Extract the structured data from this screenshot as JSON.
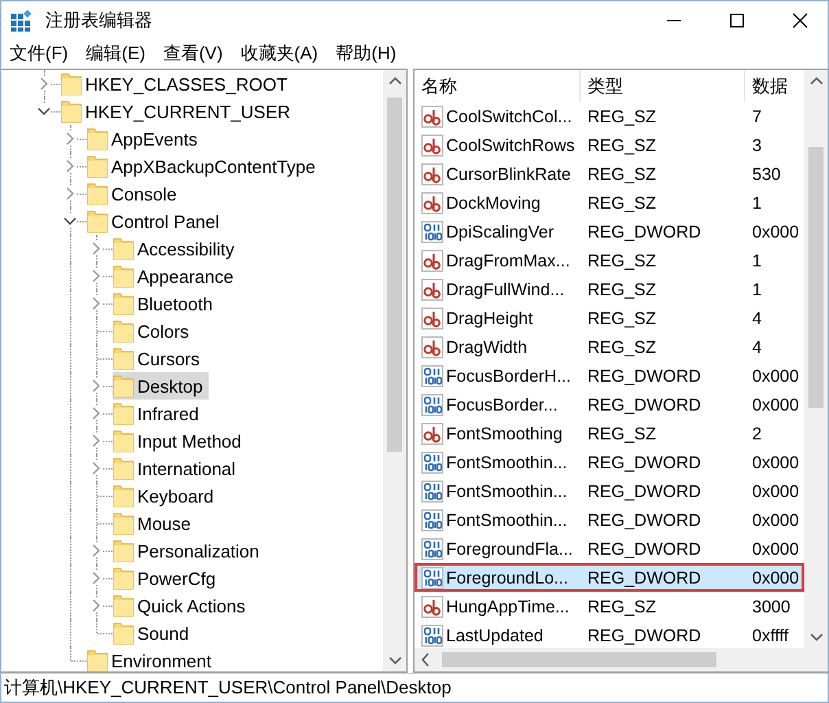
{
  "window": {
    "title": "注册表编辑器"
  },
  "menu": [
    "文件(F)",
    "编辑(E)",
    "查看(V)",
    "收藏夹(A)",
    "帮助(H)"
  ],
  "tree": [
    {
      "label": "HKEY_CLASSES_ROOT",
      "expandable": true,
      "expanded": false,
      "selected": false
    },
    {
      "label": "HKEY_CURRENT_USER",
      "expandable": true,
      "expanded": true,
      "selected": false,
      "children": [
        {
          "label": "AppEvents",
          "expandable": true,
          "expanded": false,
          "selected": false
        },
        {
          "label": "AppXBackupContentType",
          "expandable": true,
          "expanded": false,
          "selected": false
        },
        {
          "label": "Console",
          "expandable": true,
          "expanded": false,
          "selected": false
        },
        {
          "label": "Control Panel",
          "expandable": true,
          "expanded": true,
          "selected": false,
          "children": [
            {
              "label": "Accessibility",
              "expandable": true,
              "expanded": false,
              "selected": false
            },
            {
              "label": "Appearance",
              "expandable": true,
              "expanded": false,
              "selected": false
            },
            {
              "label": "Bluetooth",
              "expandable": true,
              "expanded": false,
              "selected": false
            },
            {
              "label": "Colors",
              "expandable": false,
              "selected": false
            },
            {
              "label": "Cursors",
              "expandable": false,
              "selected": false
            },
            {
              "label": "Desktop",
              "expandable": true,
              "expanded": false,
              "selected": true
            },
            {
              "label": "Infrared",
              "expandable": true,
              "expanded": false,
              "selected": false
            },
            {
              "label": "Input Method",
              "expandable": true,
              "expanded": false,
              "selected": false
            },
            {
              "label": "International",
              "expandable": true,
              "expanded": false,
              "selected": false
            },
            {
              "label": "Keyboard",
              "expandable": false,
              "selected": false
            },
            {
              "label": "Mouse",
              "expandable": false,
              "selected": false
            },
            {
              "label": "Personalization",
              "expandable": true,
              "expanded": false,
              "selected": false
            },
            {
              "label": "PowerCfg",
              "expandable": true,
              "expanded": false,
              "selected": false
            },
            {
              "label": "Quick Actions",
              "expandable": true,
              "expanded": false,
              "selected": false
            },
            {
              "label": "Sound",
              "expandable": false,
              "selected": false
            }
          ]
        },
        {
          "label": "Environment",
          "expandable": false,
          "selected": false
        }
      ]
    }
  ],
  "table": {
    "columns": [
      "名称",
      "类型",
      "数据"
    ],
    "rows": [
      {
        "kind": "string",
        "name": "CoolSwitchCol...",
        "type": "REG_SZ",
        "data": "7",
        "selected": false,
        "outlined": false
      },
      {
        "kind": "string",
        "name": "CoolSwitchRows",
        "type": "REG_SZ",
        "data": "3",
        "selected": false,
        "outlined": false
      },
      {
        "kind": "string",
        "name": "CursorBlinkRate",
        "type": "REG_SZ",
        "data": "530",
        "selected": false,
        "outlined": false
      },
      {
        "kind": "string",
        "name": "DockMoving",
        "type": "REG_SZ",
        "data": "1",
        "selected": false,
        "outlined": false
      },
      {
        "kind": "dword",
        "name": "DpiScalingVer",
        "type": "REG_DWORD",
        "data": "0x000",
        "selected": false,
        "outlined": false
      },
      {
        "kind": "string",
        "name": "DragFromMax...",
        "type": "REG_SZ",
        "data": "1",
        "selected": false,
        "outlined": false
      },
      {
        "kind": "string",
        "name": "DragFullWind...",
        "type": "REG_SZ",
        "data": "1",
        "selected": false,
        "outlined": false
      },
      {
        "kind": "string",
        "name": "DragHeight",
        "type": "REG_SZ",
        "data": "4",
        "selected": false,
        "outlined": false
      },
      {
        "kind": "string",
        "name": "DragWidth",
        "type": "REG_SZ",
        "data": "4",
        "selected": false,
        "outlined": false
      },
      {
        "kind": "dword",
        "name": "FocusBorderH...",
        "type": "REG_DWORD",
        "data": "0x000",
        "selected": false,
        "outlined": false
      },
      {
        "kind": "dword",
        "name": "FocusBorder...",
        "type": "REG_DWORD",
        "data": "0x000",
        "selected": false,
        "outlined": false
      },
      {
        "kind": "string",
        "name": "FontSmoothing",
        "type": "REG_SZ",
        "data": "2",
        "selected": false,
        "outlined": false
      },
      {
        "kind": "dword",
        "name": "FontSmoothin...",
        "type": "REG_DWORD",
        "data": "0x000",
        "selected": false,
        "outlined": false
      },
      {
        "kind": "dword",
        "name": "FontSmoothin...",
        "type": "REG_DWORD",
        "data": "0x000",
        "selected": false,
        "outlined": false
      },
      {
        "kind": "dword",
        "name": "FontSmoothin...",
        "type": "REG_DWORD",
        "data": "0x000",
        "selected": false,
        "outlined": false
      },
      {
        "kind": "dword",
        "name": "ForegroundFla...",
        "type": "REG_DWORD",
        "data": "0x000",
        "selected": false,
        "outlined": false
      },
      {
        "kind": "dword",
        "name": "ForegroundLo...",
        "type": "REG_DWORD",
        "data": "0x000",
        "selected": true,
        "outlined": true
      },
      {
        "kind": "string",
        "name": "HungAppTime...",
        "type": "REG_SZ",
        "data": "3000",
        "selected": false,
        "outlined": false
      },
      {
        "kind": "dword",
        "name": "LastUpdated",
        "type": "REG_DWORD",
        "data": "0xffff",
        "selected": false,
        "outlined": false
      }
    ]
  },
  "status_bar": "计算机\\HKEY_CURRENT_USER\\Control Panel\\Desktop"
}
